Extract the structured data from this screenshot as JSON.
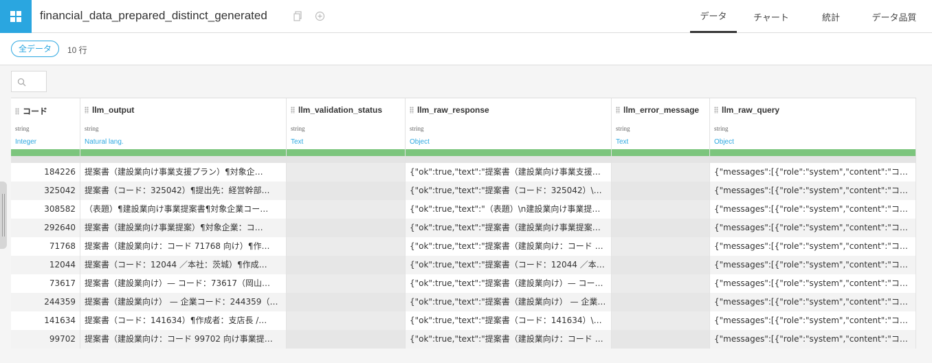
{
  "dataset": {
    "name": "financial_data_prepared_distinct_generated"
  },
  "nav": {
    "tabs": [
      "データ",
      "チャート",
      "統計",
      "データ品質"
    ],
    "active": 0
  },
  "filter": {
    "pill_label": "全データ",
    "row_count": "10 行"
  },
  "columns": [
    {
      "name": "コード",
      "type": "string",
      "meaning": "Integer"
    },
    {
      "name": "llm_output",
      "type": "string",
      "meaning": "Natural lang."
    },
    {
      "name": "llm_validation_status",
      "type": "string",
      "meaning": "Text"
    },
    {
      "name": "llm_raw_response",
      "type": "string",
      "meaning": "Object"
    },
    {
      "name": "llm_error_message",
      "type": "string",
      "meaning": "Text"
    },
    {
      "name": "llm_raw_query",
      "type": "string",
      "meaning": "Object"
    }
  ],
  "rows": [
    [
      "184226",
      "提案書（建設業向け事業支援プラン）¶対象企…",
      "",
      "{\"ok\":true,\"text\":\"提案書（建設業向け事業支援…",
      "",
      "{\"messages\":[{\"role\":\"system\",\"content\":\"コード…"
    ],
    [
      "325042",
      "提案書（コード：325042）¶提出先：経営幹部…",
      "",
      "{\"ok\":true,\"text\":\"提案書（コード：325042）\\n提…",
      "",
      "{\"messages\":[{\"role\":\"system\",\"content\":\"コード…"
    ],
    [
      "308582",
      "（表題）¶建設業向け事業提案書¶対象企業コー…",
      "",
      "{\"ok\":true,\"text\":\"（表題）\\n建設業向け事業提案…",
      "",
      "{\"messages\":[{\"role\":\"system\",\"content\":\"コード…"
    ],
    [
      "292640",
      "提案書（建設業向け事業提案）¶対象企業：コ…",
      "",
      "{\"ok\":true,\"text\":\"提案書（建設業向け事業提案…",
      "",
      "{\"messages\":[{\"role\":\"system\",\"content\":\"コード…"
    ],
    [
      "71768",
      "提案書（建設業向け：コード 71768 向け）¶作…",
      "",
      "{\"ok\":true,\"text\":\"提案書（建設業向け：コード 7…",
      "",
      "{\"messages\":[{\"role\":\"system\",\"content\":\"コード…"
    ],
    [
      "12044",
      "提案書（コード：12044 ／本社：茨城）¶作成…",
      "",
      "{\"ok\":true,\"text\":\"提案書（コード：12044 ／本社…",
      "",
      "{\"messages\":[{\"role\":\"system\",\"content\":\"コード…"
    ],
    [
      "73617",
      "提案書（建設業向け）— コード：73617（岡山…",
      "",
      "{\"ok\":true,\"text\":\"提案書（建設業向け）— コー…",
      "",
      "{\"messages\":[{\"role\":\"system\",\"content\":\"コード…"
    ],
    [
      "244359",
      "提案書（建設業向け） — 企業コード：244359（…",
      "",
      "{\"ok\":true,\"text\":\"提案書（建設業向け） — 企業…",
      "",
      "{\"messages\":[{\"role\":\"system\",\"content\":\"コード…"
    ],
    [
      "141634",
      "提案書（コード：141634）¶作成者：支店長 /…",
      "",
      "{\"ok\":true,\"text\":\"提案書（コード：141634）\\n作…",
      "",
      "{\"messages\":[{\"role\":\"system\",\"content\":\"コード…"
    ],
    [
      "99702",
      "提案書（建設業向け：コード 99702 向け事業提…",
      "",
      "{\"ok\":true,\"text\":\"提案書（建設業向け：コード 9…",
      "",
      "{\"messages\":[{\"role\":\"system\",\"content\":\"コード…"
    ]
  ],
  "colors": {
    "accent": "#2aa6e0",
    "quality": "#7cc57d"
  },
  "icons": {
    "logo": "dataset-logo-icon",
    "copy": "copy-icon",
    "share": "share-icon",
    "search": "search-icon"
  }
}
